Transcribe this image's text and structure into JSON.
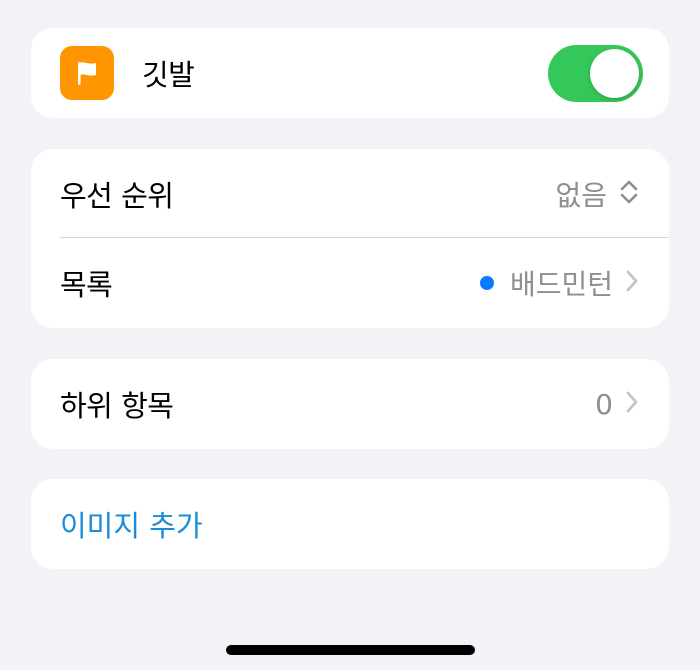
{
  "flag": {
    "label": "깃발",
    "icon": "flag-icon",
    "icon_color": "#ff9500",
    "toggle_on": true,
    "toggle_color": "#34c759"
  },
  "priority": {
    "label": "우선 순위",
    "value": "없음",
    "icon": "chevron-up-down-icon"
  },
  "list": {
    "label": "목록",
    "value": "배드민턴",
    "dot_color": "#0a7aff",
    "icon": "chevron-right-icon"
  },
  "subtasks": {
    "label": "하위 항목",
    "value": "0",
    "icon": "chevron-right-icon"
  },
  "image": {
    "label": "이미지 추가"
  }
}
